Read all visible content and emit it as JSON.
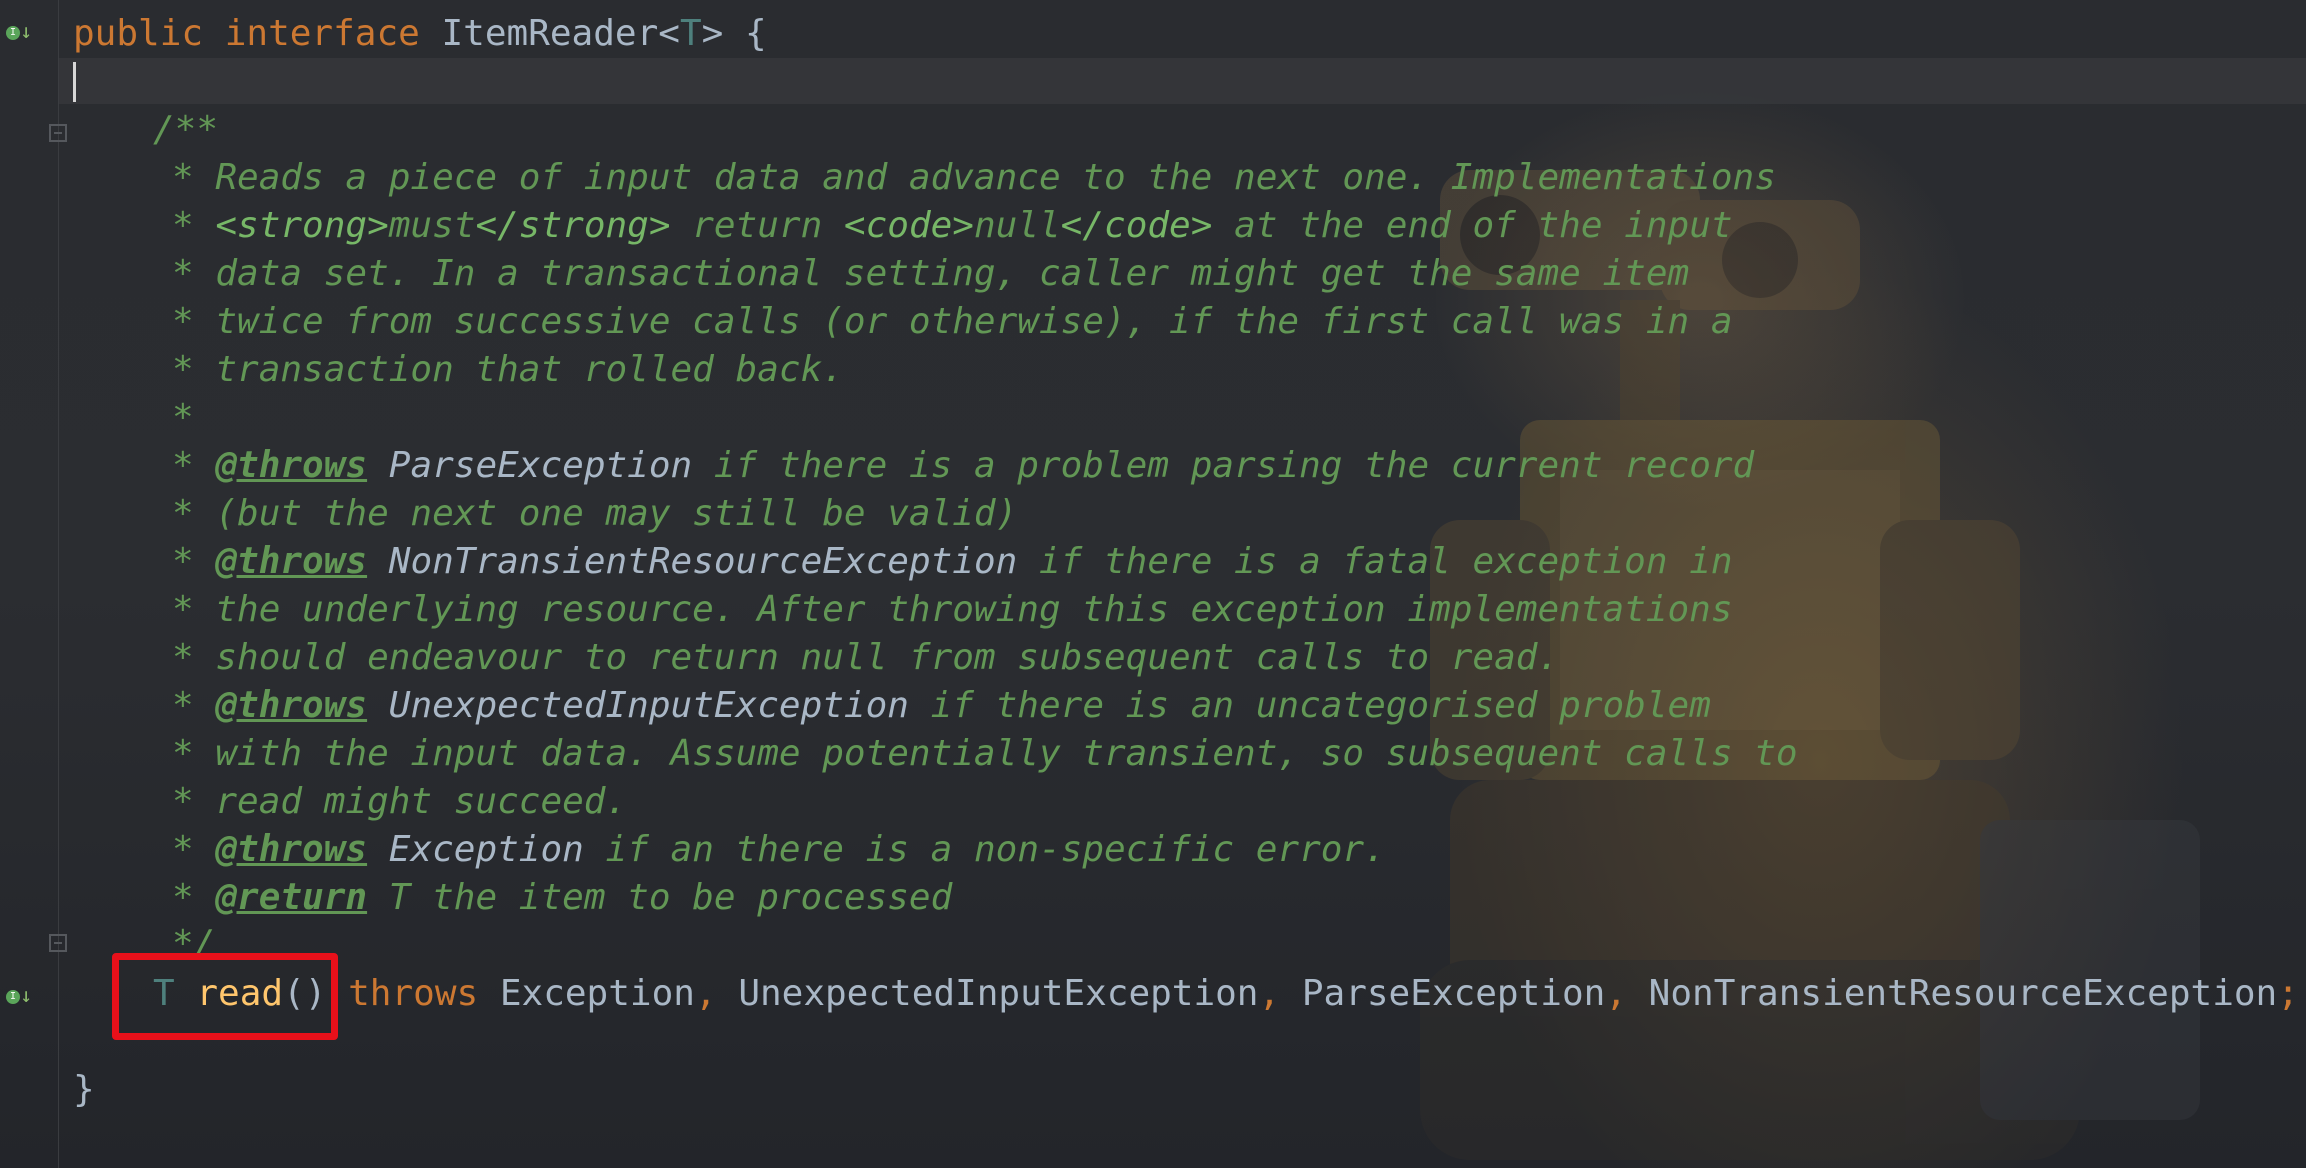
{
  "editor": {
    "declaration": {
      "public_kw": "public",
      "interface_kw": "interface",
      "name": "ItemReader",
      "lt": "<",
      "type_param": "T",
      "gt": ">",
      "brace_open": " {"
    },
    "javadoc": {
      "open": "/**",
      "lines": [
        "* Reads a piece of input data and advance to the next one. Implementations",
        "",
        "* data set. In a transactional setting, caller might get the same item",
        "* twice from successive calls (or otherwise), if the first call was in a",
        "* transaction that rolled back.",
        "*"
      ],
      "line2": {
        "star": "* ",
        "strong_open": "<strong>",
        "must": "must",
        "strong_close": "</strong>",
        "return_text": " return ",
        "code_open": "<code>",
        "null": "null",
        "code_close": "</code>",
        "rest": " at the end of the input"
      },
      "throws_tag": "@throws",
      "return_tag": "@return",
      "throws1": {
        "star": "* ",
        "ref": "ParseException",
        "text": " if there is a problem parsing the current record"
      },
      "throws1_cont": "* (but the next one may still be valid)",
      "throws2": {
        "star": "* ",
        "ref": "NonTransientResourceException",
        "text": " if there is a fatal exception in"
      },
      "throws2_cont1": "* the underlying resource. After throwing this exception implementations",
      "throws2_cont2": "* should endeavour to return null from subsequent calls to read.",
      "throws3": {
        "star": "* ",
        "ref": "UnexpectedInputException",
        "text": " if there is an uncategorised problem"
      },
      "throws3_cont1": "* with the input data. Assume potentially transient, so subsequent calls to",
      "throws3_cont2": "* read might succeed.",
      "throws4": {
        "star": "* ",
        "ref": "Exception",
        "text": " if an there is a non-specific error."
      },
      "return_line": {
        "star": "* ",
        "text": " T the item to be processed"
      },
      "close": "*/"
    },
    "method": {
      "return_type": "T",
      "name": "read",
      "parens": "()",
      "throws_kw": "throws",
      "ex1": "Exception",
      "ex2": "UnexpectedInputException",
      "ex3": "ParseException",
      "ex4": "NonTransientResourceException",
      "comma": ",",
      "semicolon": ";"
    },
    "closing_brace": "}"
  },
  "colors": {
    "background": "#2b2d31",
    "keyword": "#cc7832",
    "doc_comment": "#629755",
    "function": "#ffc66d",
    "type_param": "#4e807d",
    "highlight_box": "#e8101a"
  },
  "icons": [
    "implemented-interface-icon",
    "implemented-method-icon",
    "fold-marker-icon"
  ]
}
